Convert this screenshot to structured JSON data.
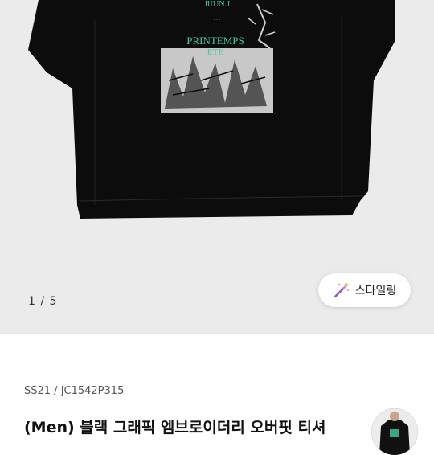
{
  "gallery": {
    "graphic_text_top": "JUUN.J",
    "graphic_text_main": "PRINTEMPS",
    "graphic_text_sub": "ETE",
    "page_current": "1",
    "page_total": "5",
    "page_indicator": "1 / 5",
    "background_color": "#ebebeb",
    "shirt_color": "#0c0c0c",
    "print_accent_color": "#43c9a0"
  },
  "styling_button": {
    "label": "스타일링",
    "icon": "magic-wand-icon",
    "icon_color": "#9b4dca"
  },
  "product": {
    "sku": "SS21 / JC1542P315",
    "title": "(Men) 블랙 그래픽 엠브로이더리 오버핏 티셔"
  }
}
